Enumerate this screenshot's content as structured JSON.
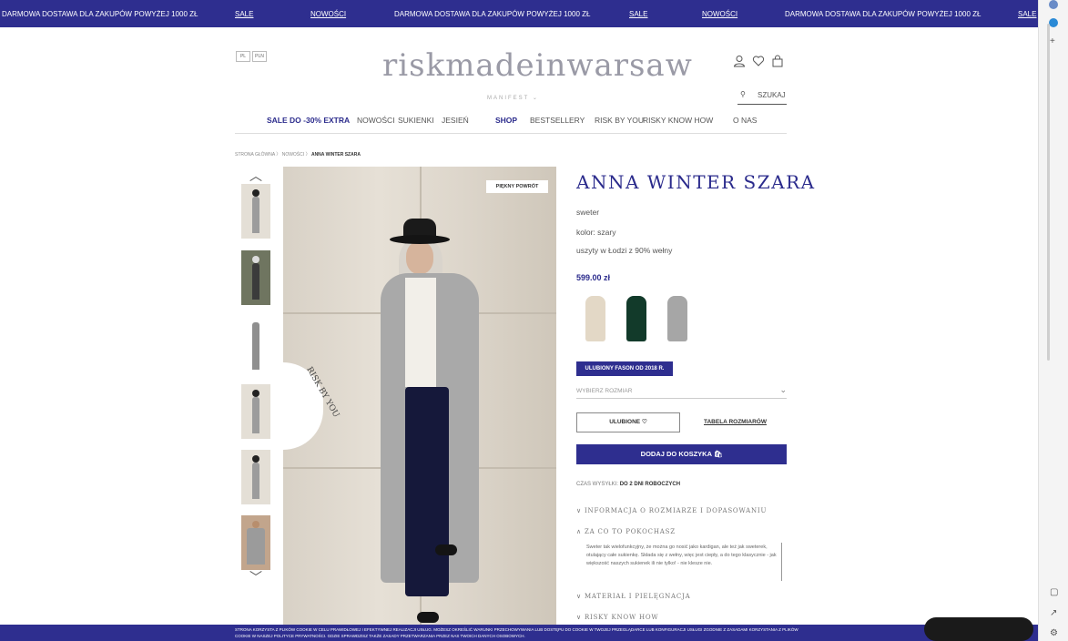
{
  "promo": {
    "items": [
      {
        "text": "DARMOWA DOSTAWA DLA ZAKUPÓW POWYŻEJ 1000 ZŁ",
        "link": false
      },
      {
        "text": "SALE",
        "link": true
      },
      {
        "text": "NOWOŚCI",
        "link": true
      },
      {
        "text": "DARMOWA DOSTAWA DLA ZAKUPÓW POWYŻEJ 1000 ZŁ",
        "link": false
      },
      {
        "text": "SALE",
        "link": true
      },
      {
        "text": "NOWOŚCI",
        "link": true
      },
      {
        "text": "DARMOWA DOSTAWA DLA ZAKUPÓW POWYŻEJ 1000 ZŁ",
        "link": false
      },
      {
        "text": "SALE",
        "link": true
      }
    ]
  },
  "header": {
    "lang_pl": "PL",
    "currency": "PLN",
    "logo": "riskmadeinwarsaw",
    "manifest": "MANIFEST",
    "search_label": "SZUKAJ",
    "icons": [
      "user-icon",
      "heart-icon",
      "bag-icon"
    ]
  },
  "nav": {
    "items": [
      "SALE DO -30% EXTRA",
      "NOWOŚCI",
      "SUKIENKI",
      "JESIEŃ",
      "SHOP",
      "BESTSELLERY",
      "RISK BY YOU",
      "RISKY KNOW HOW",
      "O NAS"
    ]
  },
  "breadcrumb": {
    "home": "STRONA GŁÓWNA",
    "sep": "〉",
    "section": "NOWOŚCI",
    "current": "ANNA WINTER SZARA"
  },
  "gallery": {
    "badge": "PIĘKNY POWRÓT",
    "risk_by_you": "RISK BY YOU"
  },
  "product": {
    "title": "ANNA WINTER SZARA",
    "type": "sweter",
    "color": "kolor: szary",
    "origin": "uszyty w Łodzi z 90% wełny",
    "price": "599.00 zł",
    "swatch_colors": [
      "#e3d8c6",
      "#123a2a",
      "#a6a6a6"
    ],
    "fav_label": "ULUBIONY FASON OD 2018 R.",
    "size_placeholder": "WYBIERZ ROZMIAR",
    "fav_button": "ULUBIONE ♡",
    "size_table": "TABELA ROZMIARÓW",
    "add_to_cart": "DODAJ DO KOSZYKA",
    "ship_prefix": "CZAS WYSYŁKI:",
    "ship_value": "DO 2 DNI ROBOCZYCH",
    "accordions": [
      {
        "label": "INFORMACJA O ROZMIARZE I DOPASOWANIU",
        "open": false
      },
      {
        "label": "ZA CO TO POKOCHASZ",
        "open": true
      },
      {
        "label": "MATERIAŁ I PIELĘGNACJA",
        "open": false
      },
      {
        "label": "RISKY KNOW HOW",
        "open": false
      }
    ],
    "accordion_text": "Sweter tak wielofunkcyjny, że można go nosić jako kardigan, ale też jak sweterek, otulający całe sukienkę. Składa się z wełny, więc jest ciepły, a do tego klasycznie - jak większość naszych sukienek ili nie tylko! - nie klesze nie."
  },
  "cookie": {
    "text": "STRONA KORZYSTA Z PLIKÓW COOKIE W CELU PRAWIDŁOWEJ I EFEKTYWNEJ REALIZACJI USŁUG. MOŻESZ OKREŚLIĆ WARUNKI PRZECHOWYWANIA LUB DOSTĘPU DO COOKIE W TWOJEJ PRZEGLĄDARCE LUB KONFIGURACJI USŁUGI ZGODNIE Z ZASADAMI KORZYSTANIA Z PLIKÓW COOKIE W NASZEJ POLITYCE PRYWATNOŚCI. GDZIE SPRAWDZISZ TAKŻE ZASADY PRZETWARZANIA PRZEZ NAS TWOICH DANYCH OSOBOWYCH."
  },
  "colors": {
    "brand": "#2e2e8f",
    "text": "#2b2b8c"
  }
}
